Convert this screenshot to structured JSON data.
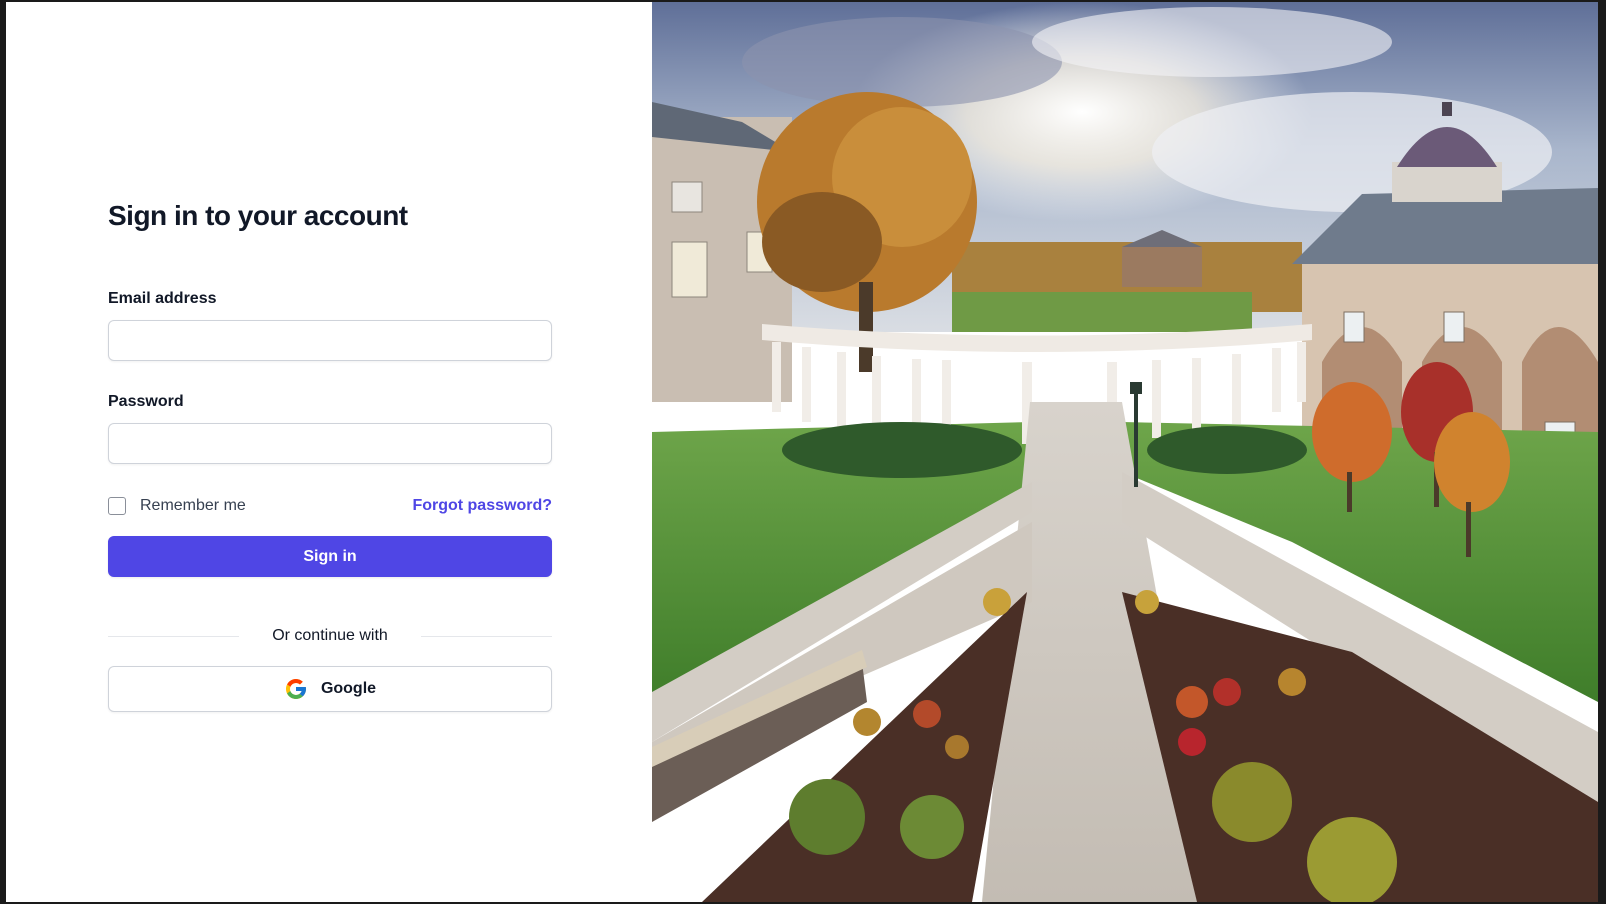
{
  "login": {
    "title": "Sign in to your account",
    "email_label": "Email address",
    "email_value": "",
    "password_label": "Password",
    "password_value": "",
    "remember_label": "Remember me",
    "remember_checked": false,
    "forgot_link": "Forgot password?",
    "signin_button": "Sign in",
    "divider_text": "Or continue with",
    "google_button": "Google"
  },
  "hero": {
    "description_icon": "campus-photo"
  },
  "colors": {
    "accent": "#4f46e5",
    "text_primary": "#111827",
    "border": "#cfd3da"
  }
}
